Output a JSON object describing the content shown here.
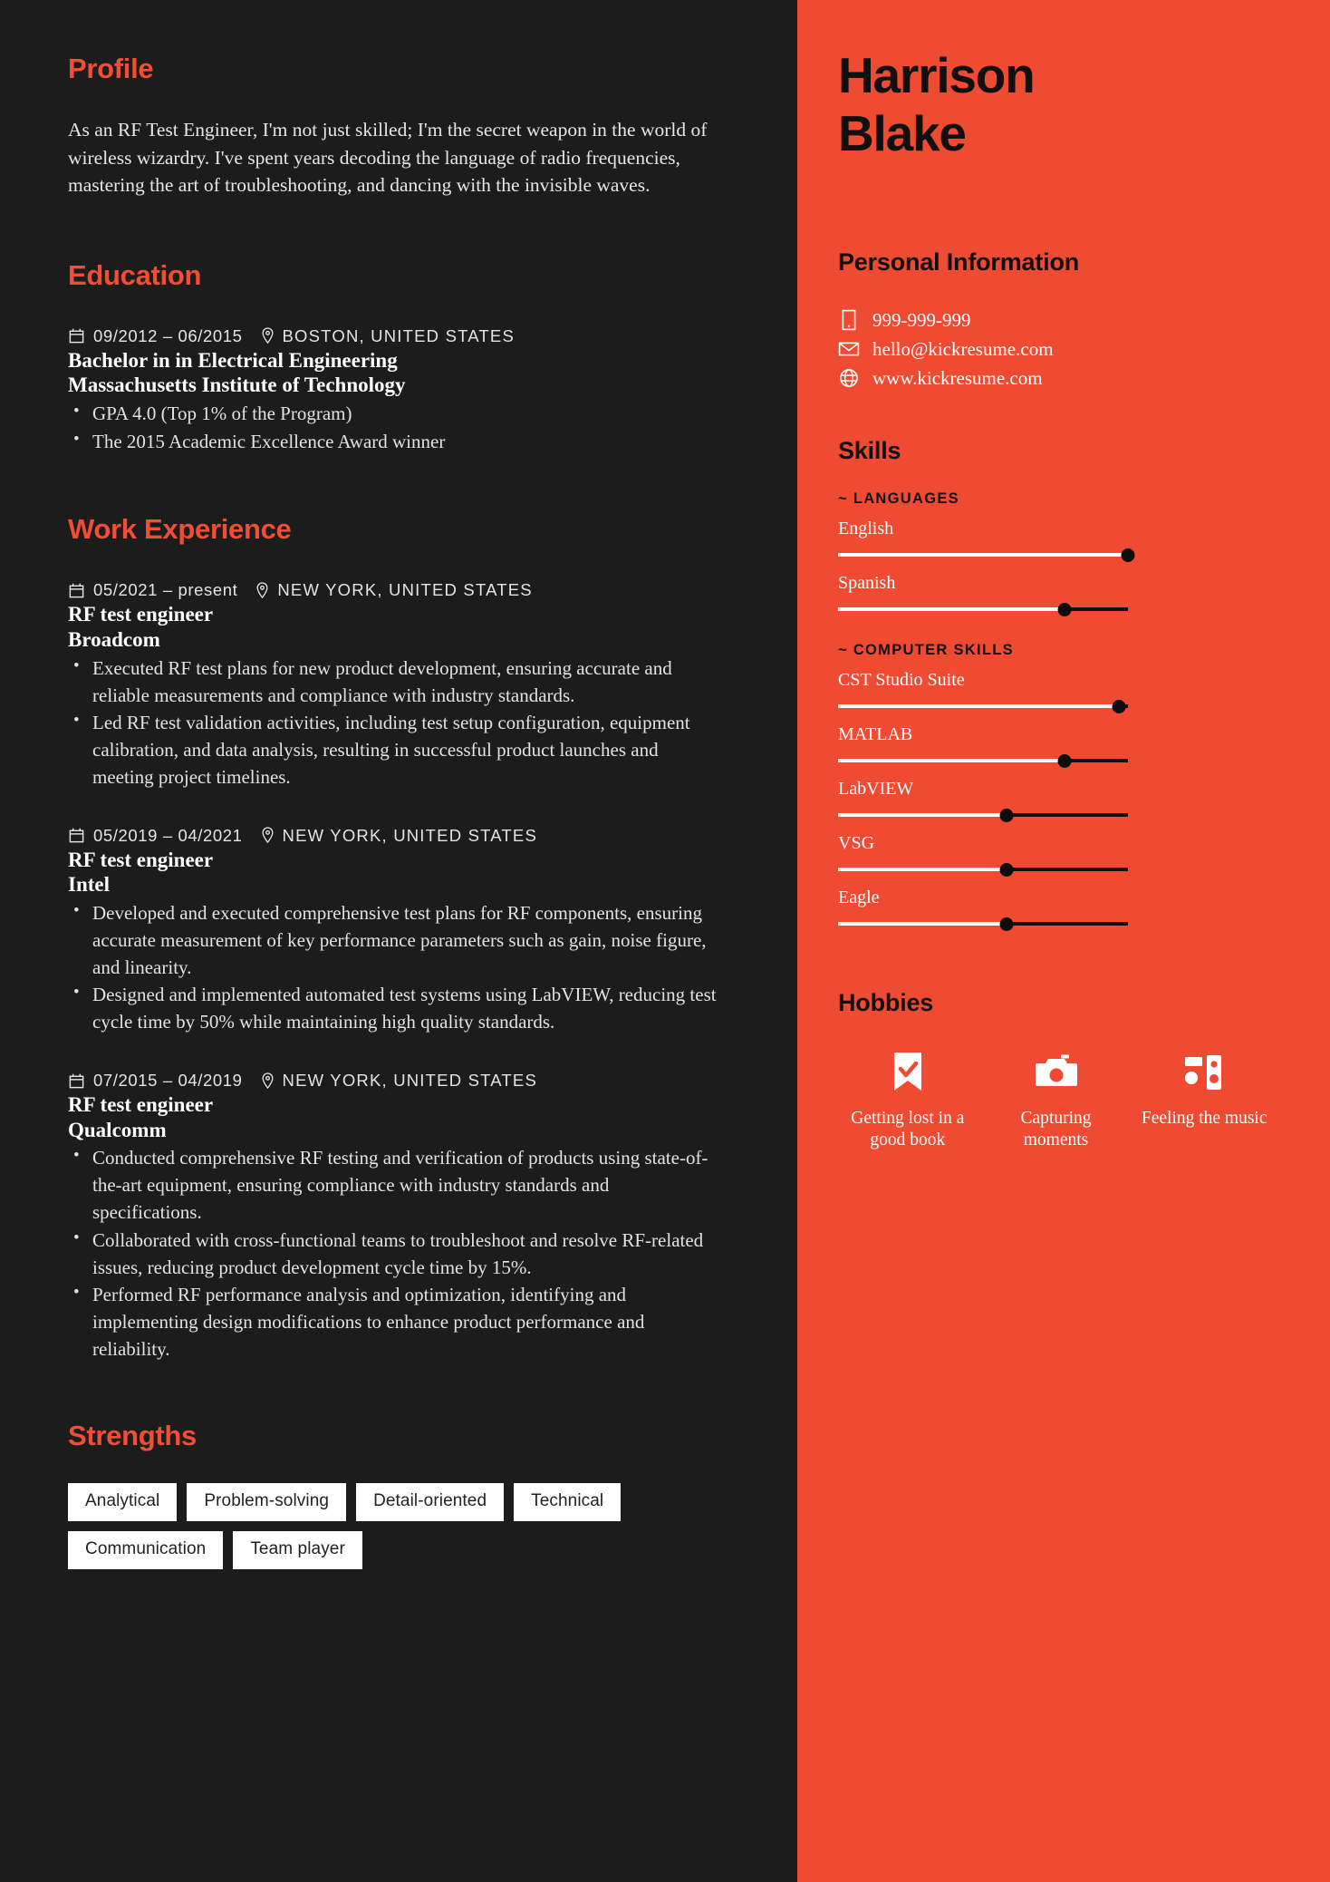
{
  "theme": {
    "dark_bg": "#1c1c1c",
    "accent": "#ef4a32",
    "heading_accent": "#f04e35",
    "text_light": "#e8e6e4",
    "tag_bg": "#ffffff"
  },
  "left": {
    "profile": {
      "title": "Profile",
      "text": "As an RF Test Engineer, I'm not just skilled; I'm the secret weapon in the world of wireless wizardry. I've spent years decoding the language of radio frequencies, mastering the art of troubleshooting, and dancing with the invisible waves."
    },
    "education": {
      "title": "Education",
      "entries": [
        {
          "dates": "09/2012 – 06/2015",
          "location": "BOSTON, UNITED STATES",
          "role": "Bachelor in in Electrical Engineering",
          "org": "Massachusetts Institute of Technology",
          "bullets": [
            "GPA 4.0 (Top 1% of the Program)",
            "The 2015 Academic Excellence Award winner"
          ]
        }
      ]
    },
    "work": {
      "title": "Work Experience",
      "entries": [
        {
          "dates": "05/2021 – present",
          "location": "NEW YORK, UNITED STATES",
          "role": "RF test engineer",
          "org": "Broadcom",
          "bullets": [
            "Executed RF test plans for new product development, ensuring accurate and reliable measurements and compliance with industry standards.",
            "Led RF test validation activities, including test setup configuration, equipment calibration, and data analysis, resulting in successful product launches and meeting project timelines."
          ]
        },
        {
          "dates": "05/2019 – 04/2021",
          "location": "NEW YORK, UNITED STATES",
          "role": "RF test engineer",
          "org": "Intel",
          "bullets": [
            "Developed and executed comprehensive test plans for RF components, ensuring accurate measurement of key performance parameters such as gain, noise figure, and linearity.",
            "Designed and implemented automated test systems using LabVIEW, reducing test cycle time by 50% while maintaining high quality standards."
          ]
        },
        {
          "dates": "07/2015 – 04/2019",
          "location": "NEW YORK, UNITED STATES",
          "role": "RF test engineer",
          "org": "Qualcomm",
          "bullets": [
            "Conducted comprehensive RF testing and verification of products using state-of-the-art equipment, ensuring compliance with industry standards and specifications.",
            "Collaborated with cross-functional teams to troubleshoot and resolve RF-related issues, reducing product development cycle time by 15%.",
            "Performed RF performance analysis and optimization, identifying and implementing design modifications to enhance product performance and reliability."
          ]
        }
      ]
    },
    "strengths": {
      "title": "Strengths",
      "tags": [
        "Analytical",
        "Problem-solving",
        "Detail-oriented",
        "Technical",
        "Communication",
        "Team player"
      ]
    }
  },
  "right": {
    "name_line1": "Harrison",
    "name_line2": "Blake",
    "personal": {
      "title": "Personal Information",
      "contacts": [
        {
          "icon": "phone-icon",
          "value": "999-999-999"
        },
        {
          "icon": "envelope-icon",
          "value": "hello@kickresume.com"
        },
        {
          "icon": "globe-icon",
          "value": "www.kickresume.com"
        }
      ]
    },
    "skills": {
      "title": "Skills",
      "groups": [
        {
          "label": "~ LANGUAGES",
          "items": [
            {
              "name": "English",
              "level": 100
            },
            {
              "name": "Spanish",
              "level": 78
            }
          ]
        },
        {
          "label": "~ COMPUTER SKILLS",
          "items": [
            {
              "name": "CST Studio Suite",
              "level": 97
            },
            {
              "name": "MATLAB",
              "level": 78
            },
            {
              "name": "LabVIEW",
              "level": 58
            },
            {
              "name": "VSG",
              "level": 58
            },
            {
              "name": "Eagle",
              "level": 58
            }
          ]
        }
      ]
    },
    "hobbies": {
      "title": "Hobbies",
      "items": [
        {
          "icon": "bookmark-check-icon",
          "label": "Getting lost in a good book"
        },
        {
          "icon": "camera-icon",
          "label": "Capturing moments"
        },
        {
          "icon": "music-device-icon",
          "label": "Feeling the music"
        }
      ]
    }
  }
}
